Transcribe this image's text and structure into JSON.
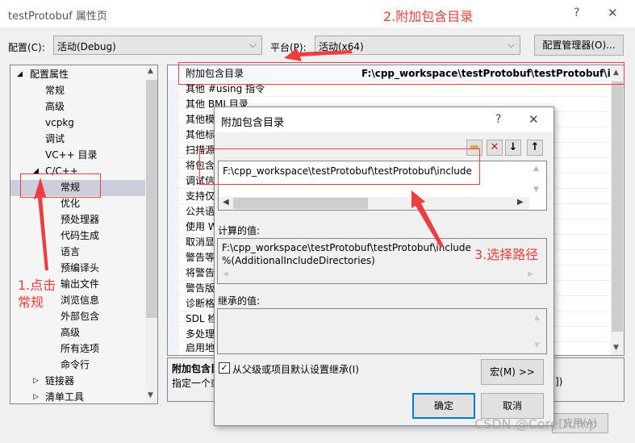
{
  "window": {
    "title": "testProtobuf 属性页",
    "help": "?",
    "close": "✕"
  },
  "config": {
    "config_label": "配置(C):",
    "config_value": "活动(Debug)",
    "platform_label": "平台(P):",
    "platform_value": "活动(x64)",
    "manager_button": "配置管理器(O)..."
  },
  "tree": {
    "items": [
      "配置属性",
      "常规",
      "高级",
      "vcpkg",
      "调试",
      "VC++ 目录",
      "C/C++",
      "常规",
      "优化",
      "预处理器",
      "代码生成",
      "语言",
      "预编译头",
      "输出文件",
      "浏览信息",
      "外部包含",
      "高级",
      "所有选项",
      "命令行",
      "链接器",
      "清单工具"
    ],
    "selected": "常规"
  },
  "grid": {
    "rows": [
      {
        "name": "附加包含目录",
        "value": "F:\\cpp_workspace\\testProtobuf\\testProtobuf\\include"
      },
      {
        "name": "其他 #using 指令"
      },
      {
        "name": "其他 BMI 目录"
      },
      {
        "name": "其他模"
      },
      {
        "name": "其他标"
      },
      {
        "name": "扫描源"
      },
      {
        "name": "将包含"
      },
      {
        "name": "调试信"
      },
      {
        "name": "支持仅"
      },
      {
        "name": "公共语"
      },
      {
        "name": "使用 W"
      },
      {
        "name": "取消显"
      },
      {
        "name": "警告等"
      },
      {
        "name": "将警告"
      },
      {
        "name": "警告版"
      },
      {
        "name": "诊断格"
      },
      {
        "name": "SDL 检"
      },
      {
        "name": "多处理"
      },
      {
        "name": "启用地"
      }
    ]
  },
  "description": {
    "title": "附加包含目",
    "text": "指定一个或",
    "text_tail": "])"
  },
  "bottom": {
    "apply": "应用(A)"
  },
  "dialog": {
    "title": "附加包含目录",
    "help": "?",
    "close": "✕",
    "entries": [
      "F:\\cpp_workspace\\testProtobuf\\testProtobuf\\include"
    ],
    "computed_label": "计算的值:",
    "computed": [
      "F:\\cpp_workspace\\testProtobuf\\testProtobuf\\include",
      "%(AdditionalIncludeDirectories)"
    ],
    "inherited_label": "继承的值:",
    "inherit_checkbox": "从父级或项目默认设置继承(I)",
    "inherit_checked": true,
    "macro_button": "宏(M) >>",
    "ok": "确定",
    "cancel": "取消"
  },
  "annotations": {
    "step1": "1.点击",
    "step1b": "常规",
    "step2": "2.附加包含目录",
    "step3": "3.选择路径",
    "color": "#f03c3c"
  },
  "watermark": "CSDN @CoreDump"
}
